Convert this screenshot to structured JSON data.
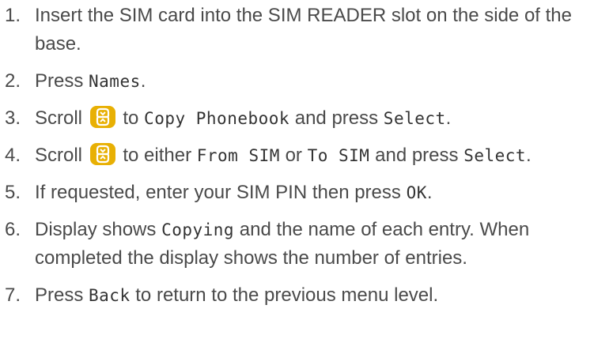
{
  "icon": {
    "name": "scroll-key-icon",
    "color": "#e8b004"
  },
  "steps": [
    {
      "number": "1.",
      "text": "Insert the SIM card into the SIM READER slot on the side of the base."
    },
    {
      "number": "2.",
      "t1": "Press ",
      "k1": "Names",
      "t2": "."
    },
    {
      "number": "3.",
      "t1": "Scroll ",
      "t2": " to ",
      "k1": "Copy Phonebook",
      "t3": " and press ",
      "k2": "Select",
      "t4": "."
    },
    {
      "number": "4.",
      "t1": "Scroll ",
      "t2": " to either ",
      "k1": "From SIM",
      "t3": " or ",
      "k2": "To SIM",
      "t4": " and press ",
      "k3": "Select",
      "t5": "."
    },
    {
      "number": "5.",
      "t1": "If requested, enter your SIM PIN then press ",
      "k1": "OK",
      "t2": "."
    },
    {
      "number": "6.",
      "t1": "Display shows ",
      "k1": "Copying",
      "t2": " and the name of each entry. When completed the display shows the number of entries."
    },
    {
      "number": "7.",
      "t1": "Press ",
      "k1": "Back",
      "t2": " to return to the previous menu level."
    }
  ]
}
